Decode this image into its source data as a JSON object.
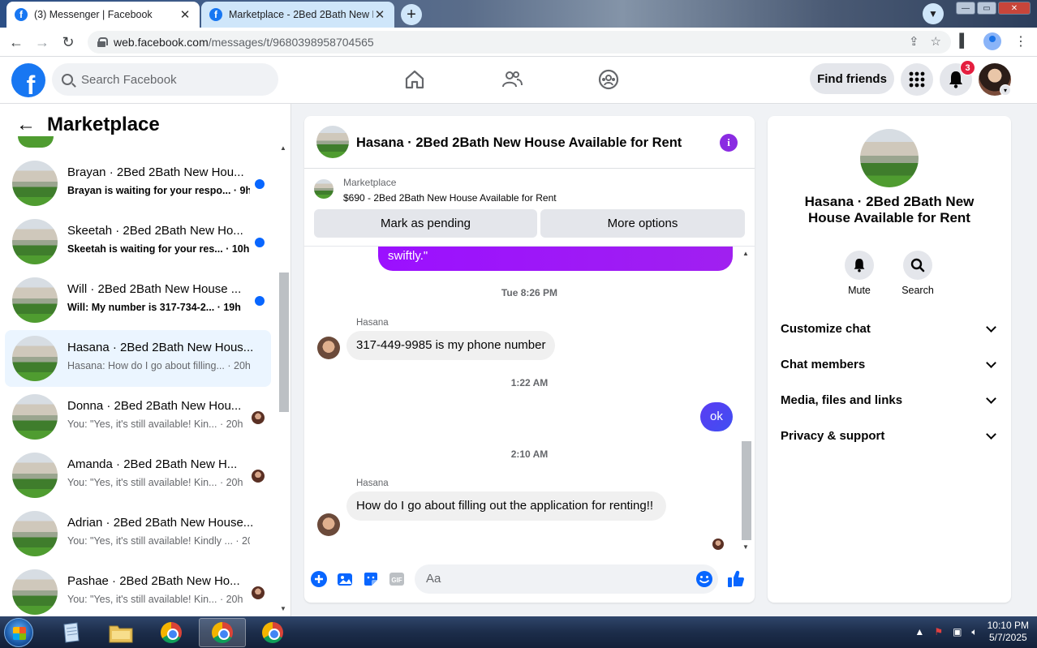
{
  "browser": {
    "tabs": [
      {
        "title": "(3) Messenger | Facebook",
        "active": true
      },
      {
        "title": "Marketplace - 2Bed 2Bath New H",
        "active": false
      }
    ],
    "url_host": "web.facebook.com",
    "url_path": "/messages/t/9680398958704565"
  },
  "fb": {
    "search_placeholder": "Search Facebook",
    "find_friends": "Find friends",
    "notification_count": "3"
  },
  "left": {
    "title": "Marketplace",
    "conversations": [
      {
        "name": "Brayan · 2Bed 2Bath New Hou...",
        "snippet": "Brayan is waiting for your respo...",
        "time": "· 9h",
        "indicator": "dot"
      },
      {
        "name": "Skeetah · 2Bed 2Bath New Ho...",
        "snippet": "Skeetah is waiting for your res...",
        "time": "· 10h",
        "indicator": "dot"
      },
      {
        "name": "Will · 2Bed 2Bath New House ...",
        "snippet": "Will: My number is 317-734-2...",
        "time": "· 19h",
        "indicator": "dot"
      },
      {
        "name": "Hasana · 2Bed 2Bath New Hous...",
        "snippet": "Hasana: How do I go about filling...",
        "time": "· 20h",
        "indicator": "none"
      },
      {
        "name": "Donna · 2Bed 2Bath New Hou...",
        "snippet": "You: \"Yes, it's still available! Kin...",
        "time": "· 20h",
        "indicator": "avatar"
      },
      {
        "name": "Amanda · 2Bed 2Bath New H...",
        "snippet": "You: \"Yes, it's still available! Kin...",
        "time": "· 20h",
        "indicator": "avatar"
      },
      {
        "name": "Adrian · 2Bed 2Bath New House...",
        "snippet": "You: \"Yes, it's still available! Kindly ...",
        "time": "· 20h",
        "indicator": "none"
      },
      {
        "name": "Pashae · 2Bed 2Bath New Ho...",
        "snippet": "You: \"Yes, it's still available! Kin...",
        "time": "· 20h",
        "indicator": "avatar"
      }
    ]
  },
  "chat": {
    "title": "Hasana · 2Bed 2Bath New House Available for Rent",
    "listing_source": "Marketplace",
    "listing_title": "$690 - 2Bed 2Bath New House Available for Rent",
    "mark_pending": "Mark as pending",
    "more_options": "More options",
    "messages": {
      "out_top": "swiftly.\"",
      "ts1": "Tue 8:26 PM",
      "sender1": "Hasana",
      "in1": "317-449-9985 is my phone number",
      "ts2": "1:22 AM",
      "out1": "ok",
      "ts3": "2:10 AM",
      "sender2": "Hasana",
      "in2": "How do I go about filling out the application for renting!!"
    },
    "composer_placeholder": "Aa"
  },
  "info": {
    "name": "Hasana · 2Bed 2Bath New House Available for Rent",
    "mute": "Mute",
    "search": "Search",
    "sections": [
      "Customize chat",
      "Chat members",
      "Media, files and links",
      "Privacy & support"
    ]
  },
  "taskbar": {
    "time": "10:10 PM",
    "date": "5/7/2025"
  },
  "colors": {
    "fb_blue": "#1877f2",
    "outgoing_purple": "#a020f0",
    "outgoing_blue": "#4d3cf5",
    "unread_dot": "#0866ff"
  }
}
